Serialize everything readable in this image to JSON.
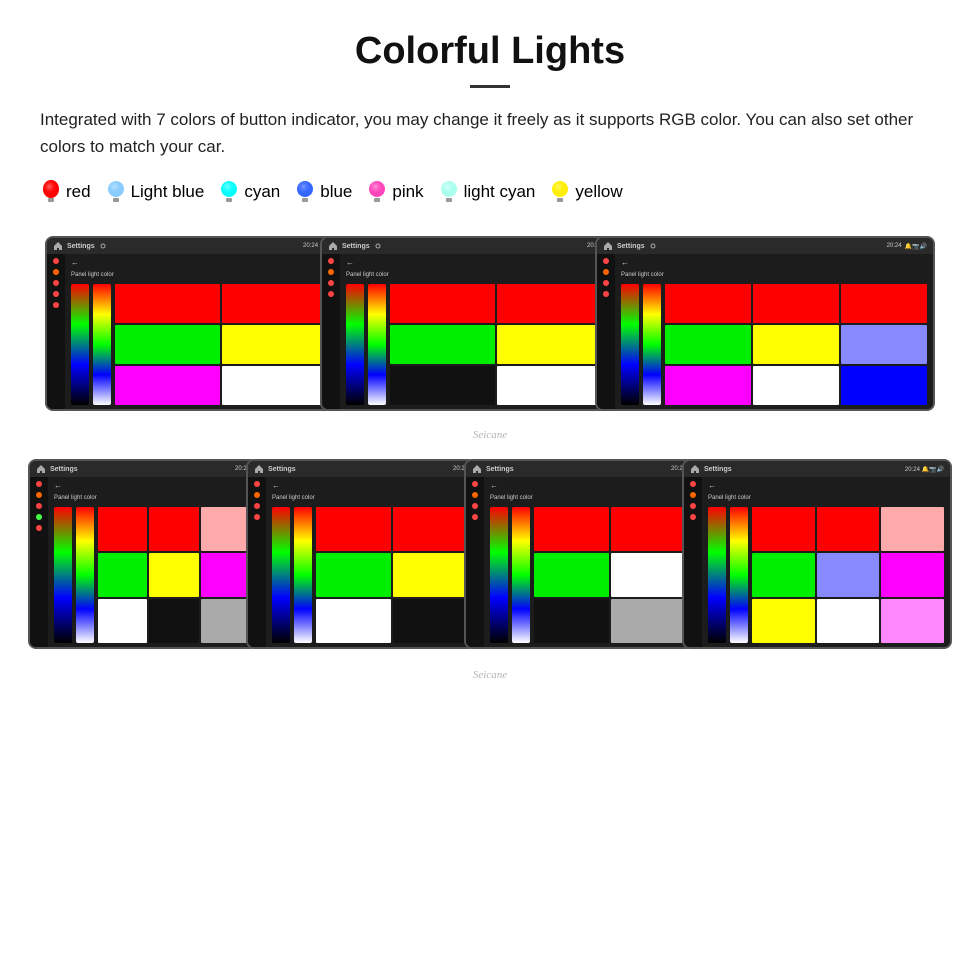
{
  "page": {
    "title": "Colorful Lights",
    "description": "Integrated with 7 colors of button indicator, you may change it freely as it supports RGB color. You can also set other colors to match your car.",
    "watermark1": "Seicane",
    "watermark2": "Seicane",
    "colors": [
      {
        "name": "red",
        "hex": "#ff0000",
        "glow": "#ff6666"
      },
      {
        "name": "Light blue",
        "hex": "#88ccff",
        "glow": "#aaddff"
      },
      {
        "name": "cyan",
        "hex": "#00ffff",
        "glow": "#66ffff"
      },
      {
        "name": "blue",
        "hex": "#3366ff",
        "glow": "#6699ff"
      },
      {
        "name": "pink",
        "hex": "#ff44bb",
        "glow": "#ff88cc"
      },
      {
        "name": "light cyan",
        "hex": "#aaffee",
        "glow": "#ccffff"
      },
      {
        "name": "yellow",
        "hex": "#ffee00",
        "glow": "#ffff66"
      }
    ],
    "top_screens": [
      {
        "label": "Settings",
        "panel_label": "Panel light color",
        "swatches": [
          "#ff0000",
          "#ff0000",
          "#00ff00",
          "#ffff00",
          "#ff00ff",
          "#ffffff"
        ]
      },
      {
        "label": "Settings",
        "panel_label": "Panel light color",
        "swatches": [
          "#ff0000",
          "#ff0000",
          "#00ff00",
          "#ffff00",
          "#000000",
          "#ffffff"
        ]
      },
      {
        "label": "Settings",
        "panel_label": "Panel light color",
        "swatches": [
          "#ff0000",
          "#ff0000",
          "#00ff00",
          "#ffff00",
          "#8888ff",
          "#ff00ff",
          "#ffffff",
          "#0000ff"
        ]
      }
    ],
    "bottom_screens": [
      {
        "label": "Settings",
        "panel_label": "Panel light color",
        "swatches": [
          "#ff0000",
          "#ff0000",
          "#ffaaaa",
          "#00ff00",
          "#ffff00",
          "#ff00ff",
          "#ffffff",
          "#000000",
          "#aaaaaa"
        ]
      },
      {
        "label": "Settings",
        "panel_label": "Panel light color",
        "swatches": [
          "#ff0000",
          "#ff0000",
          "#00ff00",
          "#ffff00",
          "#ffffff",
          "#000000"
        ]
      },
      {
        "label": "Settings",
        "panel_label": "Panel light color",
        "swatches": [
          "#ff0000",
          "#ff0000",
          "#00ff00",
          "#ffffff",
          "#000000",
          "#aaaaaa"
        ]
      },
      {
        "label": "Settings",
        "panel_label": "Panel light color",
        "swatches": [
          "#ff0000",
          "#ff0000",
          "#ffaaaa",
          "#00ff00",
          "#8888ff",
          "#ff00ff",
          "#ffff00",
          "#ffffff",
          "#ff88ff"
        ]
      }
    ]
  }
}
